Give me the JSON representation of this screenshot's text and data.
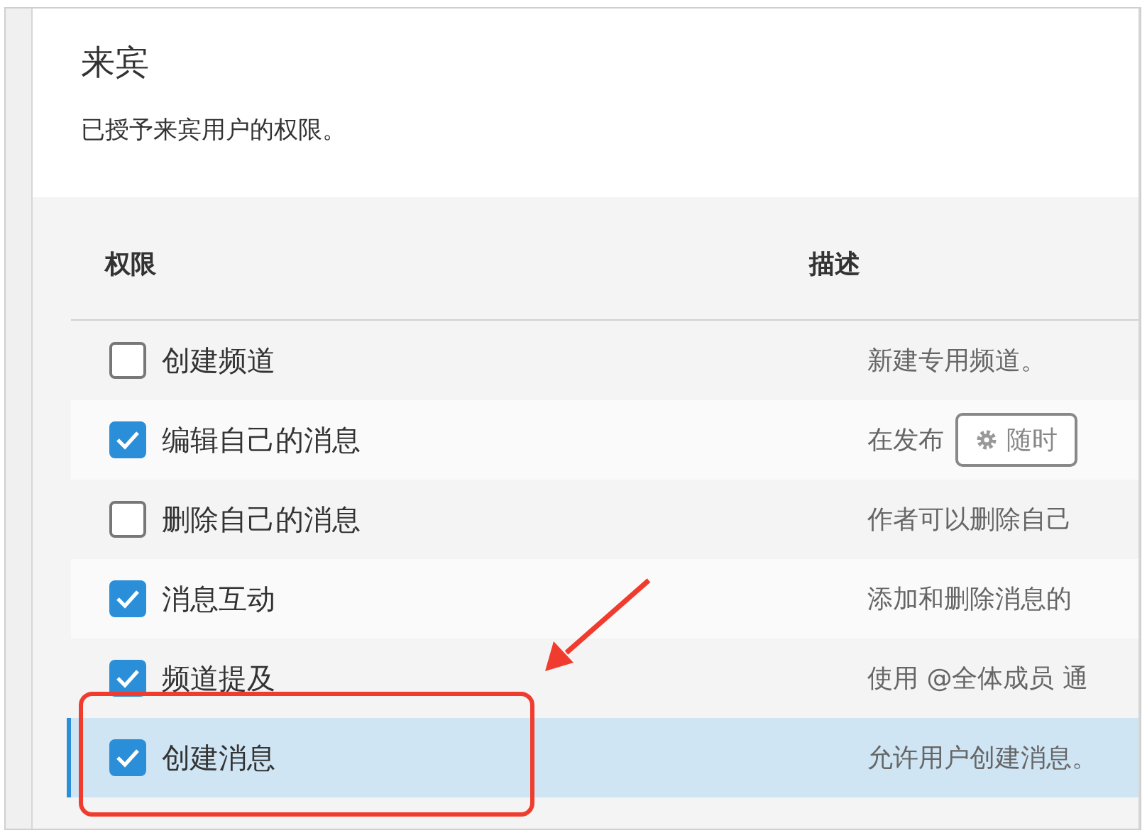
{
  "title": "来宾",
  "subtitle": "已授予来宾用户的权限。",
  "table": {
    "columns": [
      "权限",
      "描述"
    ],
    "rows": [
      {
        "label": "创建频道",
        "checked": false,
        "selected": false,
        "description": [
          {
            "kind": "text",
            "text": "新建专用频道。"
          }
        ]
      },
      {
        "label": "编辑自己的消息",
        "checked": true,
        "selected": false,
        "description": [
          {
            "kind": "text",
            "text": "在发布"
          },
          {
            "kind": "button",
            "text": "随时"
          }
        ]
      },
      {
        "label": "删除自己的消息",
        "checked": false,
        "selected": false,
        "description": [
          {
            "kind": "text",
            "text": "作者可以删除自己"
          }
        ]
      },
      {
        "label": "消息互动",
        "checked": true,
        "selected": false,
        "description": [
          {
            "kind": "text",
            "text": "添加和删除消息的"
          }
        ]
      },
      {
        "label": "频道提及",
        "checked": true,
        "selected": false,
        "description": [
          {
            "kind": "text",
            "text": "使用 @全体成员 通"
          }
        ]
      },
      {
        "label": "创建消息",
        "checked": true,
        "selected": true,
        "description": [
          {
            "kind": "text",
            "text": "允许用户创建消息。"
          }
        ]
      }
    ]
  }
}
